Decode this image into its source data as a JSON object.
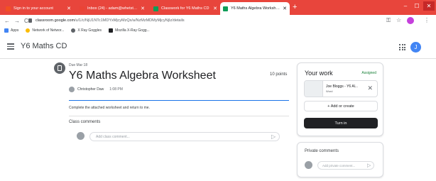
{
  "browser": {
    "tabs": [
      {
        "label": "Sign in to your account",
        "icon": "microsoft-icon",
        "color": "#f25022",
        "active": false
      },
      {
        "label": "Inbox (24) - adam@whetstoneac...",
        "icon": "gmail-icon",
        "color": "#ea4335",
        "active": false
      },
      {
        "label": "Classwork for Y6 Maths CD",
        "icon": "classroom-icon",
        "color": "#0f9d58",
        "active": false
      },
      {
        "label": "Y6 Maths Algebra Worksheet",
        "icon": "classroom-icon",
        "color": "#0f9d58",
        "active": true
      }
    ],
    "new_tab": "+",
    "window_controls": {
      "minimize": "–",
      "maximize": "☐",
      "close": "✕"
    },
    "url_host": "classroom.google.com",
    "url_path": "/u/1/c/NjU1NTc1MDYxMjcyMzQx/a/NzMzMDMyMjcyNjIz/details",
    "bookmarks": [
      {
        "label": "Apps",
        "icon": "apps-icon",
        "color": "#4285f4"
      },
      {
        "label": "Network of Networ...",
        "icon": "network-icon",
        "color": "#fbbc05"
      },
      {
        "label": "X Ray Goggles",
        "icon": "xray-icon",
        "color": "#5f6368"
      },
      {
        "label": "Mozilla X-Ray Gogg...",
        "icon": "mozilla-icon",
        "color": "#202124"
      }
    ]
  },
  "app": {
    "class_title": "Y6 Maths CD",
    "account_initial": "J"
  },
  "assignment": {
    "due": "Due Mar 18",
    "title": "Y6 Maths Algebra Worksheet",
    "points": "10 points",
    "author": "Christopher Daw",
    "time": "1:08 PM",
    "instructions": "Complete the attached worksheet and return to me.",
    "class_comments_label": "Class comments",
    "class_comment_placeholder": "Add class comment..."
  },
  "your_work": {
    "title": "Your work",
    "status": "Assigned",
    "status_color": "#188038",
    "attachment_name": "Joe Bloggs - Y6 Al...",
    "attachment_type": "Word",
    "add_label": "+ Add or create",
    "turn_in_label": "Turn in"
  },
  "private_comments": {
    "title": "Private comments",
    "placeholder": "Add private comment..."
  }
}
